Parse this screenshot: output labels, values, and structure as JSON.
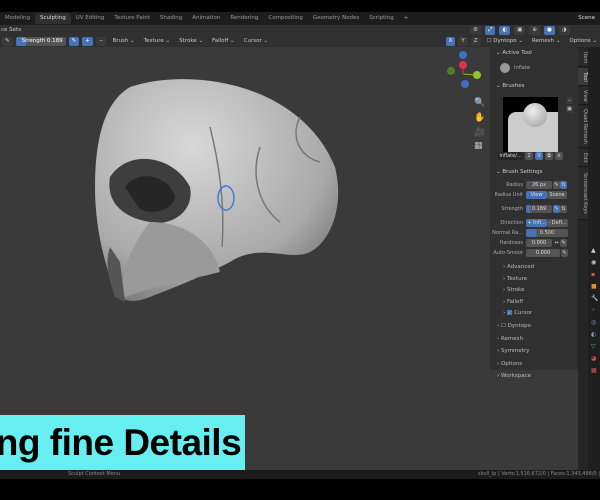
{
  "workspace_tabs": [
    "Modeling",
    "Sculpting",
    "UV Editing",
    "Texture Paint",
    "Shading",
    "Animation",
    "Rendering",
    "Compositing",
    "Geometry Nodes",
    "Scripting",
    "+"
  ],
  "active_tab": "Sculpting",
  "scene_label": "Scene",
  "header": {
    "face_sets": "ce Sets",
    "strength_label": "Strength",
    "strength_value": "0.189",
    "menus": [
      "Brush",
      "Texture",
      "Stroke",
      "Falloff",
      "Cursor"
    ],
    "axes": [
      "X",
      "Y",
      "Z"
    ],
    "right_menus": [
      "Dyntopo",
      "Remesh",
      "Options"
    ]
  },
  "sidebar": {
    "active_tool_title": "Active Tool",
    "active_tool_name": "Inflate",
    "brushes_title": "Brushes",
    "brush_name": "Inflate/...",
    "brush_users": "2",
    "brush_settings_title": "Brush Settings",
    "radius_label": "Radius",
    "radius_value": "26 px",
    "radius_unit_label": "Radius Unit",
    "radius_unit_view": "View",
    "radius_unit_scene": "Scene",
    "strength_label": "Strength",
    "strength_value": "0.189",
    "direction_label": "Direction",
    "direction_inflate": "+ Infl...",
    "direction_deflate": "- Defl...",
    "normal_radius_label": "Normal Ra...",
    "normal_radius_value": "0.500",
    "hardness_label": "Hardness",
    "hardness_value": "0.000",
    "autosmooth_label": "Auto-Smoot",
    "autosmooth_value": "0.000",
    "subpanels": [
      "Advanced",
      "Texture",
      "Stroke",
      "Falloff",
      "Cursor"
    ],
    "panels": [
      "Dyntopo",
      "Remesh",
      "Symmetry",
      "Options",
      "Workspace"
    ]
  },
  "vertical_tabs": [
    "Item",
    "Tool",
    "View",
    "Quad Remesh",
    "Edit",
    "Screencast Keys"
  ],
  "status": {
    "left": "Sculpt Context Menu",
    "right": "skull_lp | Verts:1,516,672/0 | Faces:1,343,488/0 |"
  },
  "banner": "ing fine Details"
}
